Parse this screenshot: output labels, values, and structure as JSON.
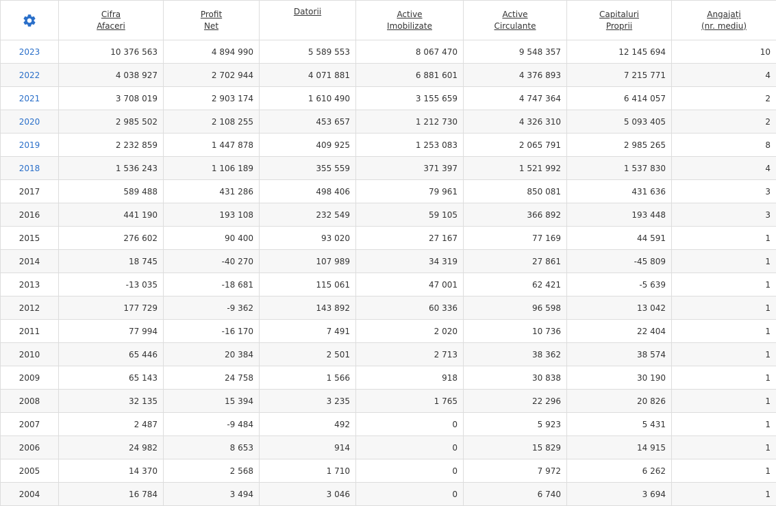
{
  "accent_color": "#2a6fc9",
  "settings_icon": "gear-icon",
  "columns": [
    {
      "line1": "Cifra",
      "line2": "Afaceri"
    },
    {
      "line1": "Profit",
      "line2": "Net"
    },
    {
      "line1": "Datorii",
      "line2": ""
    },
    {
      "line1": "Active",
      "line2": "Imobilizate"
    },
    {
      "line1": "Active",
      "line2": "Circulante"
    },
    {
      "line1": "Capitaluri",
      "line2": "Proprii"
    },
    {
      "line1": "Angajați",
      "line2": "(nr. mediu)"
    }
  ],
  "rows": [
    {
      "year": "2023",
      "link": true,
      "values": [
        "10 376 563",
        "4 894 990",
        "5 589 553",
        "8 067 470",
        "9 548 357",
        "12 145 694",
        "10"
      ]
    },
    {
      "year": "2022",
      "link": true,
      "values": [
        "4 038 927",
        "2 702 944",
        "4 071 881",
        "6 881 601",
        "4 376 893",
        "7 215 771",
        "4"
      ]
    },
    {
      "year": "2021",
      "link": true,
      "values": [
        "3 708 019",
        "2 903 174",
        "1 610 490",
        "3 155 659",
        "4 747 364",
        "6 414 057",
        "2"
      ]
    },
    {
      "year": "2020",
      "link": true,
      "values": [
        "2 985 502",
        "2 108 255",
        "453 657",
        "1 212 730",
        "4 326 310",
        "5 093 405",
        "2"
      ]
    },
    {
      "year": "2019",
      "link": true,
      "values": [
        "2 232 859",
        "1 447 878",
        "409 925",
        "1 253 083",
        "2 065 791",
        "2 985 265",
        "8"
      ]
    },
    {
      "year": "2018",
      "link": true,
      "values": [
        "1 536 243",
        "1 106 189",
        "355 559",
        "371 397",
        "1 521 992",
        "1 537 830",
        "4"
      ]
    },
    {
      "year": "2017",
      "link": false,
      "values": [
        "589 488",
        "431 286",
        "498 406",
        "79 961",
        "850 081",
        "431 636",
        "3"
      ]
    },
    {
      "year": "2016",
      "link": false,
      "values": [
        "441 190",
        "193 108",
        "232 549",
        "59 105",
        "366 892",
        "193 448",
        "3"
      ]
    },
    {
      "year": "2015",
      "link": false,
      "values": [
        "276 602",
        "90 400",
        "93 020",
        "27 167",
        "77 169",
        "44 591",
        "1"
      ]
    },
    {
      "year": "2014",
      "link": false,
      "values": [
        "18 745",
        "-40 270",
        "107 989",
        "34 319",
        "27 861",
        "-45 809",
        "1"
      ]
    },
    {
      "year": "2013",
      "link": false,
      "values": [
        "-13 035",
        "-18 681",
        "115 061",
        "47 001",
        "62 421",
        "-5 639",
        "1"
      ]
    },
    {
      "year": "2012",
      "link": false,
      "values": [
        "177 729",
        "-9 362",
        "143 892",
        "60 336",
        "96 598",
        "13 042",
        "1"
      ]
    },
    {
      "year": "2011",
      "link": false,
      "values": [
        "77 994",
        "-16 170",
        "7 491",
        "2 020",
        "10 736",
        "22 404",
        "1"
      ]
    },
    {
      "year": "2010",
      "link": false,
      "values": [
        "65 446",
        "20 384",
        "2 501",
        "2 713",
        "38 362",
        "38 574",
        "1"
      ]
    },
    {
      "year": "2009",
      "link": false,
      "values": [
        "65 143",
        "24 758",
        "1 566",
        "918",
        "30 838",
        "30 190",
        "1"
      ]
    },
    {
      "year": "2008",
      "link": false,
      "values": [
        "32 135",
        "15 394",
        "3 235",
        "1 765",
        "22 296",
        "20 826",
        "1"
      ]
    },
    {
      "year": "2007",
      "link": false,
      "values": [
        "2 487",
        "-9 484",
        "492",
        "0",
        "5 923",
        "5 431",
        "1"
      ]
    },
    {
      "year": "2006",
      "link": false,
      "values": [
        "24 982",
        "8 653",
        "914",
        "0",
        "15 829",
        "14 915",
        "1"
      ]
    },
    {
      "year": "2005",
      "link": false,
      "values": [
        "14 370",
        "2 568",
        "1 710",
        "0",
        "7 972",
        "6 262",
        "1"
      ]
    },
    {
      "year": "2004",
      "link": false,
      "values": [
        "16 784",
        "3 494",
        "3 046",
        "0",
        "6 740",
        "3 694",
        "1"
      ]
    }
  ]
}
